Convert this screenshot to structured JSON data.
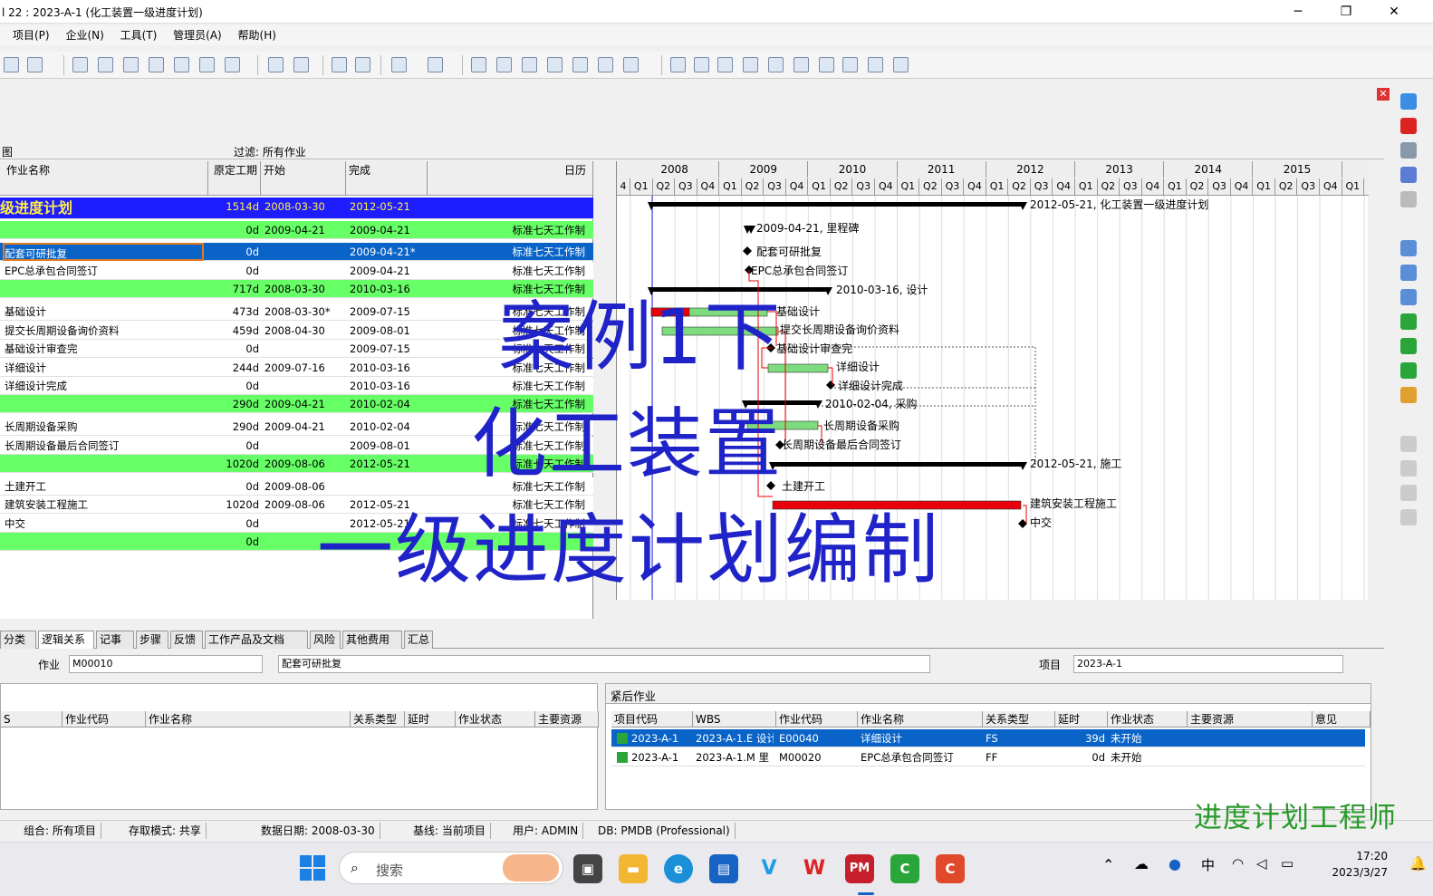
{
  "window": {
    "title": "l 22 : 2023-A-1 (化工装置一级进度计划)"
  },
  "menu": [
    "项目(P)",
    "企业(N)",
    "工具(T)",
    "管理员(A)",
    "帮助(H)"
  ],
  "filter": {
    "label_left": "图",
    "label": "过滤: 所有作业"
  },
  "columns": {
    "name": "作业名称",
    "dur": "原定工期",
    "start": "开始",
    "finish": "完成",
    "cal": "日历"
  },
  "rows": [
    {
      "name": "级进度计划",
      "dur": "1514d",
      "start": "2008-03-30",
      "finish": "2012-05-21",
      "cal": "",
      "style": "project"
    },
    {
      "name": "",
      "dur": "0d",
      "start": "2009-04-21",
      "finish": "2009-04-21",
      "cal": "标准七天工作制",
      "style": "wbs"
    },
    {
      "name": "配套可研批复",
      "dur": "0d",
      "start": "",
      "finish": "2009-04-21*",
      "cal": "标准七天工作制",
      "style": "selected"
    },
    {
      "name": "EPC总承包合同签订",
      "dur": "0d",
      "start": "",
      "finish": "2009-04-21",
      "cal": "标准七天工作制",
      "style": "task"
    },
    {
      "name": "",
      "dur": "717d",
      "start": "2008-03-30",
      "finish": "2010-03-16",
      "cal": "标准七天工作制",
      "style": "wbs"
    },
    {
      "name": "基础设计",
      "dur": "473d",
      "start": "2008-03-30*",
      "finish": "2009-07-15",
      "cal": "标准七天工作制",
      "style": "task"
    },
    {
      "name": "提交长周期设备询价资料",
      "dur": "459d",
      "start": "2008-04-30",
      "finish": "2009-08-01",
      "cal": "标准七天工作制",
      "style": "task"
    },
    {
      "name": "基础设计审查完",
      "dur": "0d",
      "start": "",
      "finish": "2009-07-15",
      "cal": "标准七天工作制",
      "style": "task"
    },
    {
      "name": "详细设计",
      "dur": "244d",
      "start": "2009-07-16",
      "finish": "2010-03-16",
      "cal": "标准七天工作制",
      "style": "task"
    },
    {
      "name": "详细设计完成",
      "dur": "0d",
      "start": "",
      "finish": "2010-03-16",
      "cal": "标准七天工作制",
      "style": "task"
    },
    {
      "name": "",
      "dur": "290d",
      "start": "2009-04-21",
      "finish": "2010-02-04",
      "cal": "标准七天工作制",
      "style": "wbs"
    },
    {
      "name": "长周期设备采购",
      "dur": "290d",
      "start": "2009-04-21",
      "finish": "2010-02-04",
      "cal": "标准七天工作制",
      "style": "task"
    },
    {
      "name": "长周期设备最后合同签订",
      "dur": "0d",
      "start": "",
      "finish": "2009-08-01",
      "cal": "标准七天工作制",
      "style": "task"
    },
    {
      "name": "",
      "dur": "1020d",
      "start": "2009-08-06",
      "finish": "2012-05-21",
      "cal": "标准七天工作制",
      "style": "wbs"
    },
    {
      "name": "土建开工",
      "dur": "0d",
      "start": "2009-08-06",
      "finish": "",
      "cal": "标准七天工作制",
      "style": "task"
    },
    {
      "name": "建筑安装工程施工",
      "dur": "1020d",
      "start": "2009-08-06",
      "finish": "2012-05-21",
      "cal": "标准七天工作制",
      "style": "task"
    },
    {
      "name": "中交",
      "dur": "0d",
      "start": "",
      "finish": "2012-05-21",
      "cal": "标准七天工作制",
      "style": "task"
    },
    {
      "name": "",
      "dur": "0d",
      "start": "",
      "finish": "",
      "cal": "",
      "style": "wbs"
    }
  ],
  "gantt": {
    "years": [
      "2008",
      "2009",
      "2010",
      "2011",
      "2012",
      "2013",
      "2014",
      "2015"
    ],
    "q_first": "4",
    "quarters": [
      "Q1",
      "Q2",
      "Q3",
      "Q4"
    ],
    "labels": [
      "2012-05-21, 化工装置一级进度计划",
      "2009-04-21, 里程碑",
      "配套可研批复",
      "EPC总承包合同签订",
      "2010-03-16, 设计",
      "基础设计",
      "提交长周期设备询价资料",
      "基础设计审查完",
      "详细设计",
      "详细设计完成",
      "2010-02-04, 采购",
      "长周期设备采购",
      "长周期设备最后合同签订",
      "2012-05-21, 施工",
      "土建开工",
      "建筑安装工程施工",
      "中交"
    ]
  },
  "overlay": {
    "line1": "案例1下",
    "line2": "化工装置",
    "line3": "一级进度计划编制",
    "watermark": "进度计划工程师"
  },
  "tabs": [
    "分类码",
    "逻辑关系",
    "记事本",
    "步骤",
    "反馈",
    "工作产品及文档",
    "风险",
    "其他费用",
    "汇总"
  ],
  "detail": {
    "activity_label": "作业",
    "activity_id": "M00010",
    "activity_name": "配套可研批复",
    "project_label": "项目",
    "project_value": "2023-A-1",
    "pred_headers": [
      "S",
      "作业代码",
      "作业名称",
      "关系类型",
      "延时",
      "作业状态",
      "主要资源"
    ],
    "succ_title": "紧后作业",
    "succ_headers": [
      "项目代码",
      "WBS",
      "作业代码",
      "作业名称",
      "关系类型",
      "延时",
      "作业状态",
      "主要资源",
      "意见"
    ],
    "succ_rows": [
      [
        "2023-A-1",
        "2023-A-1.E 设计",
        "E00040",
        "详细设计",
        "FS",
        "39d",
        "未开始",
        "",
        ""
      ],
      [
        "2023-A-1",
        "2023-A-1.M 里",
        "M00020",
        "EPC总承包合同签订",
        "FF",
        "0d",
        "未开始",
        "",
        ""
      ]
    ]
  },
  "status": [
    "组合: 所有项目",
    "存取模式: 共享",
    "数据日期: 2008-03-30",
    "基线: 当前项目",
    "用户: ADMIN",
    "DB: PMDB (Professional)"
  ],
  "taskbar": {
    "search_placeholder": "搜索",
    "ime": "中",
    "time": "17:20",
    "date": "2023/3/27"
  },
  "colors": {
    "selected": "#0a64c8",
    "wbs": "#66ff66",
    "project": "#1d1dff",
    "bar_red": "#e8000a",
    "bar_green": "#7ddc7d"
  }
}
